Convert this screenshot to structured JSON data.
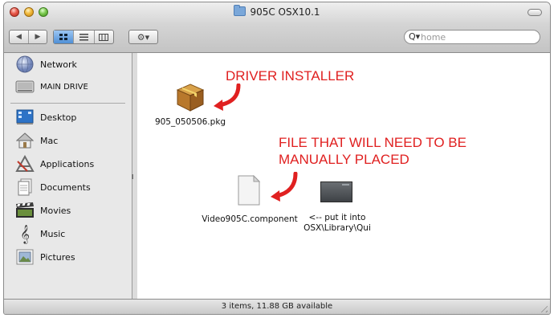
{
  "window": {
    "title": "905C OSX10.1"
  },
  "toolbar": {
    "back_icon": "back-arrow-icon",
    "forward_icon": "forward-arrow-icon",
    "view_icon": "icon-view",
    "list_icon": "list-view",
    "column_icon": "column-view",
    "action_icon": "gear-icon",
    "search_placeholder": "home"
  },
  "sidebar": {
    "devices": [
      {
        "label": "Network",
        "icon": "network-globe-icon"
      },
      {
        "label": "MAIN DRIVE",
        "icon": "hard-drive-icon"
      }
    ],
    "places": [
      {
        "label": "Desktop",
        "icon": "desktop-icon"
      },
      {
        "label": "Mac",
        "icon": "home-icon"
      },
      {
        "label": "Applications",
        "icon": "applications-icon"
      },
      {
        "label": "Documents",
        "icon": "documents-icon"
      },
      {
        "label": "Movies",
        "icon": "movies-icon"
      },
      {
        "label": "Music",
        "icon": "music-icon"
      },
      {
        "label": "Pictures",
        "icon": "pictures-icon"
      }
    ]
  },
  "files": [
    {
      "name": "905_050506.pkg",
      "icon": "package-box-icon"
    },
    {
      "name": "Video905C.component",
      "icon": "blank-document-icon"
    },
    {
      "name": "<-- put it into OSX\\Library\\Qui",
      "icon": "image-thumbnail-icon"
    }
  ],
  "annotations": {
    "driver_installer": "DRIVER INSTALLER",
    "manual_line1": "FILE THAT WILL NEED TO BE",
    "manual_line2": "MANUALLY PLACED",
    "color": "#e02020"
  },
  "status": {
    "text": "3 items, 11.88 GB available"
  },
  "third_file_label": {
    "line1": "<-- put it into",
    "line2": "OSX\\Library\\Qui"
  }
}
